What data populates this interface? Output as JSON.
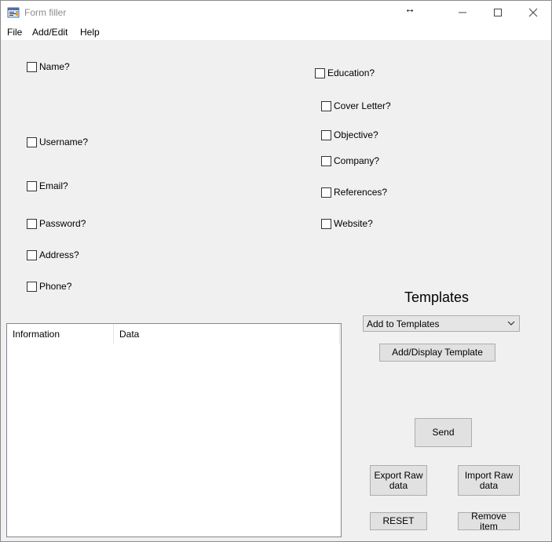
{
  "window": {
    "title": "Form filler",
    "minimize_glyph": "—",
    "maximize_glyph": "☐",
    "close_glyph": "✕",
    "resize_glyph": "↔"
  },
  "menu": {
    "file": "File",
    "add_edit": "Add/Edit",
    "help": "Help"
  },
  "checkboxes": {
    "name": "Name?",
    "username": "Username?",
    "email": "Email?",
    "password": "Password?",
    "address": "Address?",
    "phone": "Phone?",
    "education": "Education?",
    "cover_letter": "Cover Letter?",
    "objective": "Objective?",
    "company": "Company?",
    "references": "References?",
    "website": "Website?"
  },
  "listview": {
    "columns": [
      "Information",
      "Data"
    ]
  },
  "templates": {
    "heading": "Templates",
    "combo_value": "Add to Templates",
    "add_display_button": "Add/Display Template"
  },
  "buttons": {
    "send": "Send",
    "export_raw": "Export Raw data",
    "import_raw": "Import Raw data",
    "reset": "RESET",
    "remove_item": "Remove item"
  }
}
